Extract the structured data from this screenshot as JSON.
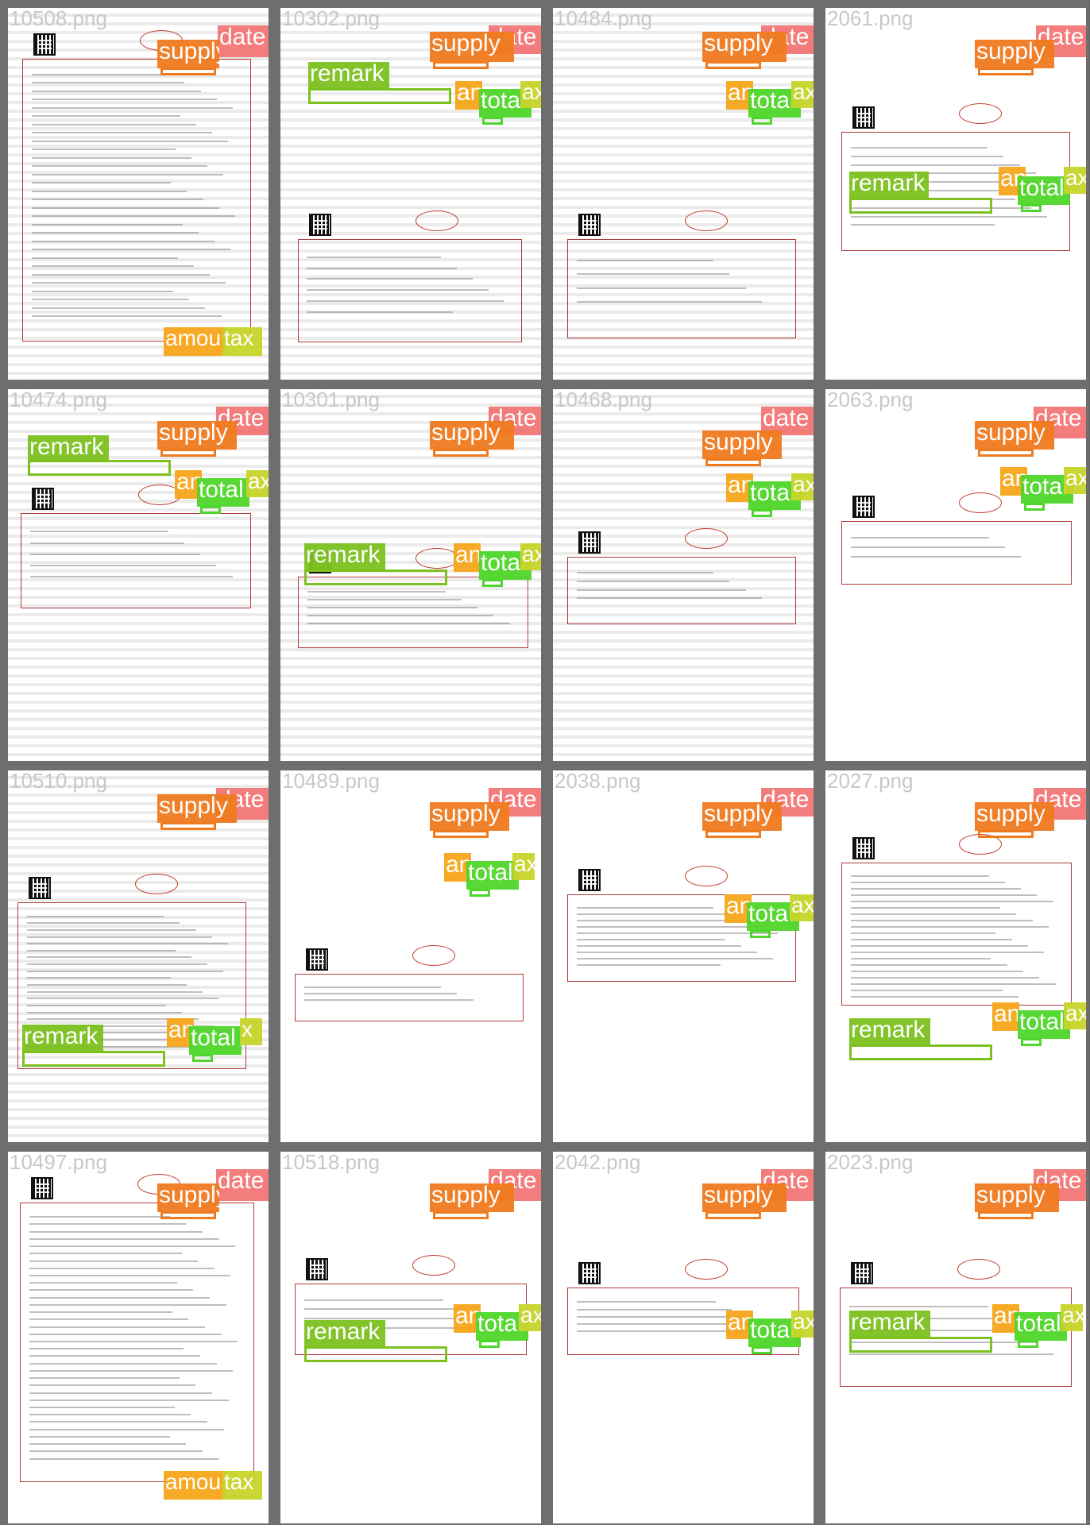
{
  "tiles": [
    {
      "filename": "10508.png",
      "labels": [
        {
          "text": "date",
          "kind": "date"
        },
        {
          "text": "supply",
          "kind": "supply"
        },
        {
          "text": "amou",
          "kind": "amount"
        },
        {
          "text": "tax",
          "kind": "tax"
        }
      ]
    },
    {
      "filename": "10302.png",
      "labels": [
        {
          "text": "date",
          "kind": "date"
        },
        {
          "text": "supply",
          "kind": "supply"
        },
        {
          "text": "remark",
          "kind": "remark"
        },
        {
          "text": "an",
          "kind": "amount"
        },
        {
          "text": "total",
          "kind": "total"
        },
        {
          "text": "ax",
          "kind": "tax"
        }
      ]
    },
    {
      "filename": "10484.png",
      "labels": [
        {
          "text": "date",
          "kind": "date"
        },
        {
          "text": "supply",
          "kind": "supply"
        },
        {
          "text": "an",
          "kind": "amount"
        },
        {
          "text": "total",
          "kind": "total"
        },
        {
          "text": "ax",
          "kind": "tax"
        }
      ]
    },
    {
      "filename": "2061.png",
      "labels": [
        {
          "text": "date",
          "kind": "date"
        },
        {
          "text": "supply",
          "kind": "supply"
        },
        {
          "text": "remark",
          "kind": "remark"
        },
        {
          "text": "an",
          "kind": "amount"
        },
        {
          "text": "total",
          "kind": "total"
        },
        {
          "text": "ax",
          "kind": "tax"
        }
      ]
    },
    {
      "filename": "10474.png",
      "labels": [
        {
          "text": "date",
          "kind": "date"
        },
        {
          "text": "supply",
          "kind": "supply"
        },
        {
          "text": "remark",
          "kind": "remark"
        },
        {
          "text": "an",
          "kind": "amount"
        },
        {
          "text": "total",
          "kind": "total"
        },
        {
          "text": "ax",
          "kind": "tax"
        }
      ]
    },
    {
      "filename": "10301.png",
      "labels": [
        {
          "text": "date",
          "kind": "date"
        },
        {
          "text": "supply",
          "kind": "supply"
        },
        {
          "text": "remark",
          "kind": "remark"
        },
        {
          "text": "an",
          "kind": "amount"
        },
        {
          "text": "total",
          "kind": "total"
        },
        {
          "text": "ax",
          "kind": "tax"
        }
      ]
    },
    {
      "filename": "10468.png",
      "labels": [
        {
          "text": "date",
          "kind": "date"
        },
        {
          "text": "supply",
          "kind": "supply"
        },
        {
          "text": "an",
          "kind": "amount"
        },
        {
          "text": "total",
          "kind": "total"
        },
        {
          "text": "ax",
          "kind": "tax"
        }
      ]
    },
    {
      "filename": "2063.png",
      "labels": [
        {
          "text": "date",
          "kind": "date"
        },
        {
          "text": "supply",
          "kind": "supply"
        },
        {
          "text": "an",
          "kind": "amount"
        },
        {
          "text": "total",
          "kind": "total"
        },
        {
          "text": "ax",
          "kind": "tax"
        }
      ]
    },
    {
      "filename": "10510.png",
      "labels": [
        {
          "text": "date",
          "kind": "date"
        },
        {
          "text": "supply",
          "kind": "supply"
        },
        {
          "text": "remark",
          "kind": "remark"
        },
        {
          "text": "an",
          "kind": "amount"
        },
        {
          "text": "total",
          "kind": "total"
        },
        {
          "text": "x",
          "kind": "tax"
        }
      ]
    },
    {
      "filename": "10489.png",
      "labels": [
        {
          "text": "date",
          "kind": "date"
        },
        {
          "text": "supply",
          "kind": "supply"
        },
        {
          "text": "an",
          "kind": "amount"
        },
        {
          "text": "total",
          "kind": "total"
        },
        {
          "text": "ax",
          "kind": "tax"
        }
      ]
    },
    {
      "filename": "2038.png",
      "labels": [
        {
          "text": "date",
          "kind": "date"
        },
        {
          "text": "supply",
          "kind": "supply"
        },
        {
          "text": "an",
          "kind": "amount"
        },
        {
          "text": "total",
          "kind": "total"
        },
        {
          "text": "ax",
          "kind": "tax"
        }
      ]
    },
    {
      "filename": "2027.png",
      "labels": [
        {
          "text": "date",
          "kind": "date"
        },
        {
          "text": "supply",
          "kind": "supply"
        },
        {
          "text": "remark",
          "kind": "remark"
        },
        {
          "text": "an",
          "kind": "amount"
        },
        {
          "text": "total",
          "kind": "total"
        },
        {
          "text": "ax",
          "kind": "tax"
        }
      ]
    },
    {
      "filename": "10497.png",
      "labels": [
        {
          "text": "date",
          "kind": "date"
        },
        {
          "text": "supply",
          "kind": "supply"
        },
        {
          "text": "amou",
          "kind": "amount"
        },
        {
          "text": "tax",
          "kind": "tax"
        }
      ]
    },
    {
      "filename": "10518.png",
      "labels": [
        {
          "text": "date",
          "kind": "date"
        },
        {
          "text": "supply",
          "kind": "supply"
        },
        {
          "text": "remark",
          "kind": "remark"
        },
        {
          "text": "an",
          "kind": "amount"
        },
        {
          "text": "total",
          "kind": "total"
        },
        {
          "text": "ax",
          "kind": "tax"
        }
      ]
    },
    {
      "filename": "2042.png",
      "labels": [
        {
          "text": "date",
          "kind": "date"
        },
        {
          "text": "supply",
          "kind": "supply"
        },
        {
          "text": "an",
          "kind": "amount"
        },
        {
          "text": "total",
          "kind": "total"
        },
        {
          "text": "ax",
          "kind": "tax"
        }
      ]
    },
    {
      "filename": "2023.png",
      "labels": [
        {
          "text": "date",
          "kind": "date"
        },
        {
          "text": "supply",
          "kind": "supply"
        },
        {
          "text": "remark",
          "kind": "remark"
        },
        {
          "text": "an",
          "kind": "amount"
        },
        {
          "text": "total",
          "kind": "total"
        },
        {
          "text": "ax",
          "kind": "tax"
        }
      ]
    }
  ],
  "colors": {
    "date": "#f26b6b",
    "supply": "#f07a1e",
    "remark": "#7dc11f",
    "amount": "#f7a61a",
    "total": "#4fd62a",
    "tax": "#c8d42a",
    "background": "#6e6e6e",
    "filename": "#c8c8c8",
    "invoice_red": "#b03a3a"
  }
}
